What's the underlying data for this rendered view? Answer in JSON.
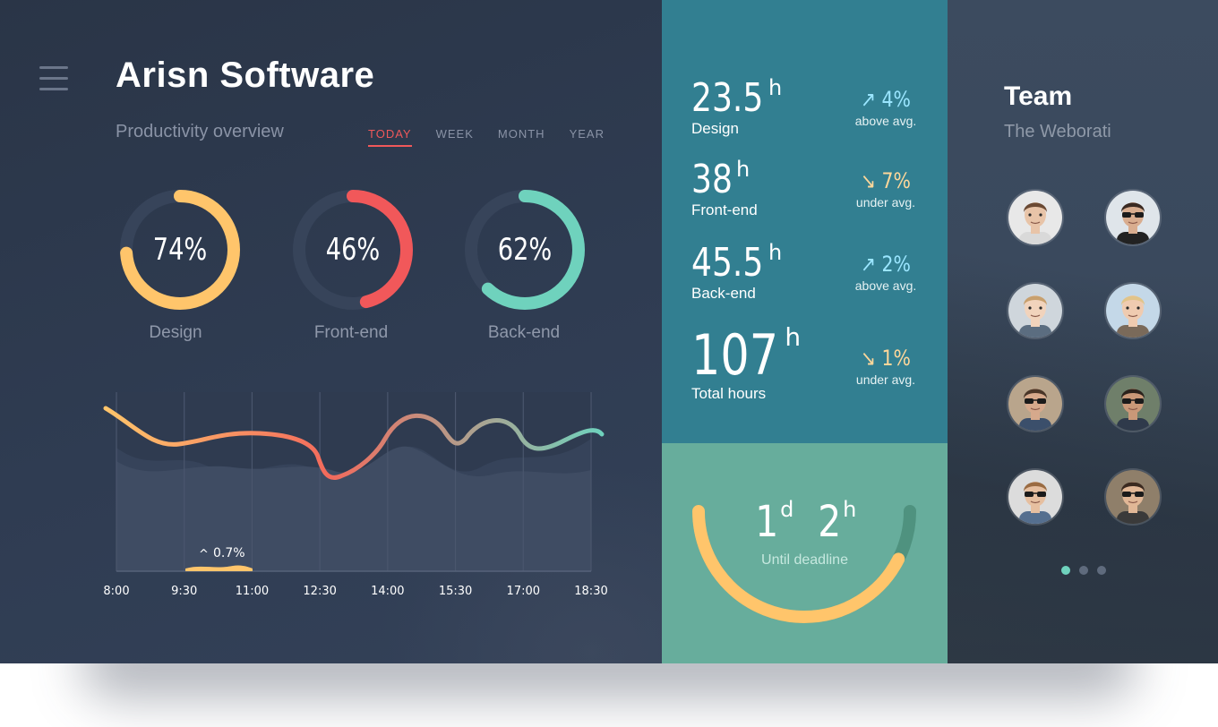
{
  "header": {
    "app_title": "Arisn Software",
    "subtitle": "Productivity overview",
    "menu_icon": "hamburger-menu-icon"
  },
  "tabs": [
    {
      "label": "TODAY",
      "active": true
    },
    {
      "label": "WEEK",
      "active": false
    },
    {
      "label": "MONTH",
      "active": false
    },
    {
      "label": "YEAR",
      "active": false
    }
  ],
  "donuts": [
    {
      "value_text": "74%",
      "value": 0.74,
      "label": "Design",
      "color": "#ffc56b"
    },
    {
      "value_text": "46%",
      "value": 0.46,
      "label": "Front-end",
      "color": "#f1585a"
    },
    {
      "value_text": "62%",
      "value": 0.62,
      "label": "Back-end",
      "color": "#6fd2bd"
    }
  ],
  "chart_data": {
    "type": "area",
    "x": [
      "8:00",
      "9:30",
      "11:00",
      "12:30",
      "14:00",
      "15:30",
      "17:00",
      "18:30"
    ],
    "highlight": {
      "range": [
        "9:30",
        "11:00"
      ],
      "label": "0.7%"
    },
    "gradient_colors": [
      "#ffc56b",
      "#f36a5c",
      "#6fd2bd"
    ]
  },
  "stats": [
    {
      "value": "23.5",
      "unit": "h",
      "label": "Design",
      "trend_dir": "up",
      "trend": "4%",
      "trend_note": "above avg."
    },
    {
      "value": "38",
      "unit": "h",
      "label": "Front-end",
      "trend_dir": "down",
      "trend": "7%",
      "trend_note": "under avg."
    },
    {
      "value": "45.5",
      "unit": "h",
      "label": "Back-end",
      "trend_dir": "up",
      "trend": "2%",
      "trend_note": "above avg."
    },
    {
      "value": "107",
      "unit": "h",
      "label": "Total hours",
      "trend_dir": "down",
      "trend": "1%",
      "trend_note": "under avg."
    }
  ],
  "trend_icons": {
    "up": "↗",
    "down": "↘"
  },
  "deadline": {
    "days": "1",
    "days_unit": "d",
    "hours": "2",
    "hours_unit": "h",
    "label": "Until deadline",
    "progress": 0.85
  },
  "team": {
    "title": "Team",
    "subtitle": "The Weborati",
    "members": [
      {
        "name": "team-member-1",
        "skin": "#e8c4a8",
        "hair": "#6b4a34",
        "shirt": "#d9d9d9",
        "bg": "#e8e8e8",
        "glasses": false
      },
      {
        "name": "team-member-2",
        "skin": "#d9ad8f",
        "hair": "#3a2a22",
        "shirt": "#222222",
        "bg": "#dfe5ea",
        "glasses": true
      },
      {
        "name": "team-member-3",
        "skin": "#f1d3bc",
        "hair": "#c8a06e",
        "shirt": "#5b6d80",
        "bg": "#cfd6dc",
        "glasses": false
      },
      {
        "name": "team-member-4",
        "skin": "#efcbb0",
        "hair": "#e1c48a",
        "shirt": "#7a6a5a",
        "bg": "#c4d8e8",
        "glasses": false
      },
      {
        "name": "team-member-5",
        "skin": "#d6a98c",
        "hair": "#4a3628",
        "shirt": "#3b4f6b",
        "bg": "#b9a58c",
        "glasses": true
      },
      {
        "name": "team-member-6",
        "skin": "#c99878",
        "hair": "#2b221c",
        "shirt": "#2f3a4b",
        "bg": "#6f7f6a",
        "glasses": true
      },
      {
        "name": "team-member-7",
        "skin": "#e6bfa0",
        "hair": "#9a6b42",
        "shirt": "#556f8f",
        "bg": "#dcdcdc",
        "glasses": true
      },
      {
        "name": "team-member-8",
        "skin": "#e1b796",
        "hair": "#3b2a20",
        "shirt": "#3a3a3a",
        "bg": "#8f7f6a",
        "glasses": true
      }
    ]
  },
  "pagination": {
    "count": 3,
    "active": 0
  }
}
